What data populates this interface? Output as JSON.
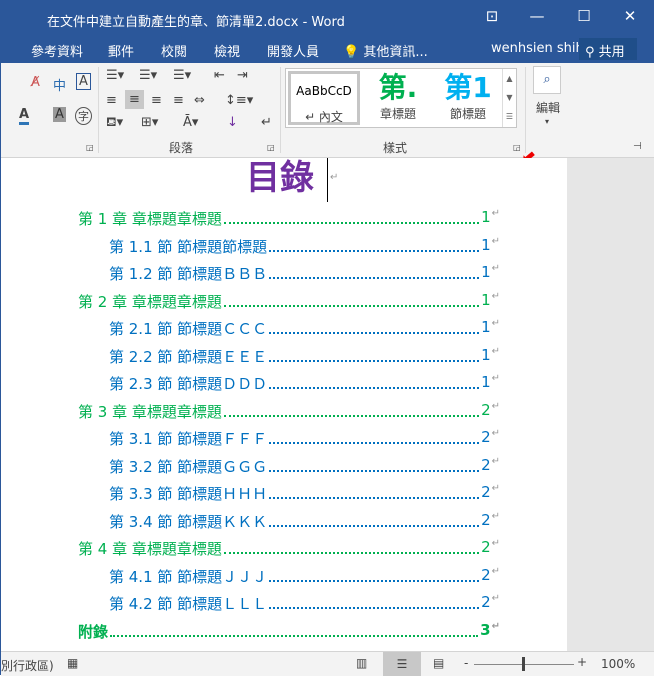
{
  "window": {
    "title": "在文件中建立自動產生的章、節清單2.docx - Word",
    "restore_ribbon": "⊡",
    "minimize": "—",
    "maximize": "☐",
    "close": "✕"
  },
  "tabs": [
    "參考資料",
    "郵件",
    "校閱",
    "檢視",
    "開發人員"
  ],
  "tell_me": "其他資訊...",
  "user": "wenhsien shih",
  "share": "共用",
  "ribbon": {
    "paragraph_label": "段落",
    "styles_label": "樣式",
    "editing_label": "編輯",
    "styles": [
      {
        "preview": "AaBbCcD",
        "name": "↵ 內文"
      },
      {
        "preview": "第.",
        "name": "章標題"
      },
      {
        "preview": "第1",
        "name": "節標題"
      }
    ]
  },
  "document": {
    "heading": "目錄",
    "toc": [
      {
        "level": 1,
        "text": "第 1 章  章標題章標題",
        "page": "1"
      },
      {
        "level": 2,
        "text": "第 1.1 節  節標題節標題",
        "page": "1"
      },
      {
        "level": 2,
        "text": "第 1.2 節  節標題ＢＢＢ",
        "page": "1"
      },
      {
        "level": 1,
        "text": "第 2 章  章標題章標題",
        "page": "1"
      },
      {
        "level": 2,
        "text": "第 2.1 節  節標題ＣＣＣ",
        "page": "1"
      },
      {
        "level": 2,
        "text": "第 2.2 節  節標題ＥＥＥ",
        "page": "1"
      },
      {
        "level": 2,
        "text": "第 2.3 節  節標題ＤＤＤ",
        "page": "1"
      },
      {
        "level": 1,
        "text": "第 3 章  章標題章標題",
        "page": "2"
      },
      {
        "level": 2,
        "text": "第 3.1 節  節標題ＦＦＦ",
        "page": "2"
      },
      {
        "level": 2,
        "text": "第 3.2 節  節標題ＧＧＧ",
        "page": "2"
      },
      {
        "level": 2,
        "text": "第 3.3 節  節標題ＨＨＨ",
        "page": "2"
      },
      {
        "level": 2,
        "text": "第 3.4 節  節標題ＫＫＫ",
        "page": "2"
      },
      {
        "level": 1,
        "text": "第 4 章  章標題章標題",
        "page": "2"
      },
      {
        "level": 2,
        "text": "第 4.1 節  節標題ＪＪＪ",
        "page": "2"
      },
      {
        "level": 2,
        "text": "第 4.2 節  節標題ＬＬＬ",
        "page": "2"
      },
      {
        "level": 1,
        "text": "附錄       ",
        "page": "3"
      }
    ]
  },
  "status": {
    "language": "別行政區)",
    "zoom": "100%",
    "zoom_minus": "-",
    "zoom_plus": "+"
  }
}
